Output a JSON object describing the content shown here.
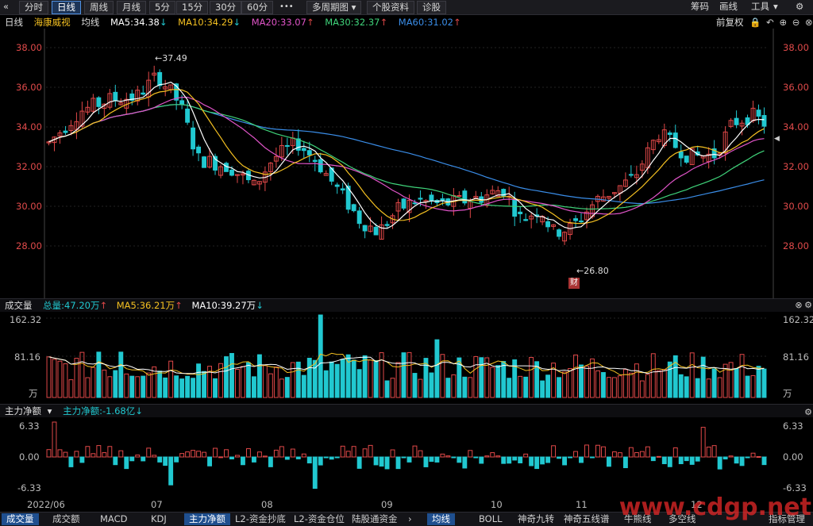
{
  "toolbar": {
    "back_icon": "double-chevron-left-icon",
    "periods": [
      "分时",
      "日线",
      "周线",
      "月线",
      "5分",
      "15分",
      "30分",
      "60分",
      "多周期图",
      "个股资料",
      "诊股"
    ],
    "active_period": "日线",
    "right": [
      "筹码",
      "画线",
      "工具"
    ],
    "right_icons": [
      "tools-dropdown-icon",
      "settings-icon"
    ]
  },
  "legend": {
    "period": "日线",
    "stock": "海康威视",
    "avg": "均线",
    "ma5": "MA5:34.38",
    "ma10": "MA10:34.29",
    "ma20": "MA20:33.07",
    "ma30": "MA30:32.37",
    "ma60": "MA60:31.02",
    "fuquan": "前复权",
    "colors": {
      "ma5": "#ffffff",
      "ma10": "#f4c021",
      "ma20": "#e054c8",
      "ma30": "#3fd37a",
      "ma60": "#3a8de8",
      "up": "#e04848",
      "down": "#21c8d0"
    }
  },
  "price_axis": [
    "38.00",
    "36.00",
    "34.00",
    "32.00",
    "30.00",
    "28.00"
  ],
  "annotations": {
    "high": "37.49",
    "low": "26.80",
    "event": "财"
  },
  "volume": {
    "title": "成交量",
    "total": "总量:47.20万",
    "ma5": "MA5:36.21万",
    "ma10": "MA10:39.27万",
    "axis": [
      "162.32",
      "81.16",
      "万"
    ]
  },
  "flow": {
    "title": "主力净额",
    "value": "主力净额:-1.68亿",
    "axis": [
      "6.33",
      "0.00",
      "-6.33"
    ]
  },
  "dates": [
    "2022/06",
    "07",
    "08",
    "09",
    "10",
    "11",
    "12"
  ],
  "bottom_tabs": [
    "成交量",
    "成交额",
    "MACD",
    "KDJ",
    "主力净额",
    "L2-资金抄底",
    "L2-资金仓位",
    "陆股通资金",
    "均线",
    "BOLL",
    "神奇九转",
    "神奇五线谱",
    "牛熊线",
    "多空线",
    "指标管理"
  ],
  "active_tabs": [
    "成交量",
    "主力净额",
    "均线"
  ],
  "watermark": "www.cdgp.net"
}
